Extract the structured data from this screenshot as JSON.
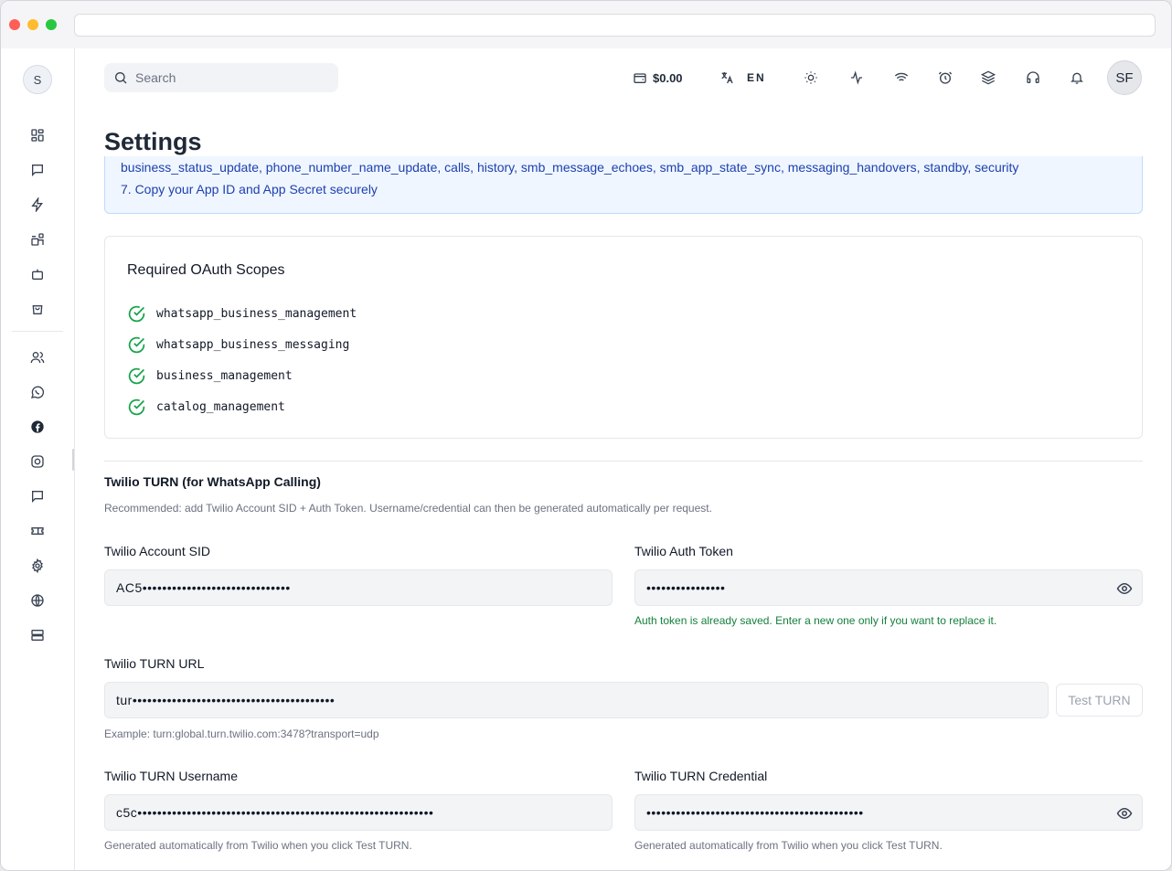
{
  "window": {
    "traffic_lights": [
      "#ff5f57",
      "#febc2e",
      "#28c840"
    ]
  },
  "sidebar": {
    "logo_letter": "S",
    "icons": [
      "dashboard-icon",
      "chat-icon",
      "lightning-icon",
      "apps-icon",
      "bot-icon",
      "shopping-bag-icon",
      "users-icon",
      "whatsapp-icon",
      "facebook-icon",
      "instagram-icon",
      "message-icon",
      "ticket-icon",
      "gear-icon",
      "globe-icon",
      "server-icon"
    ]
  },
  "header": {
    "search_placeholder": "Search",
    "wallet_amount": "$0.00",
    "language": "EN",
    "icons": [
      "sun-icon",
      "activity-icon",
      "wifi-icon",
      "alarm-icon",
      "layers-icon",
      "headset-icon",
      "bell-icon"
    ],
    "avatar_initials": "SF"
  },
  "page": {
    "title": "Settings"
  },
  "info": {
    "line1": "business_status_update, phone_number_name_update, calls, history, smb_message_echoes, smb_app_state_sync, messaging_handovers, standby, security",
    "line2": "7. Copy your App ID and App Secret securely"
  },
  "oauth": {
    "title": "Required OAuth Scopes",
    "scopes": [
      "whatsapp_business_management",
      "whatsapp_business_messaging",
      "business_management",
      "catalog_management"
    ],
    "check_color": "#16a34a"
  },
  "twilio": {
    "title": "Twilio TURN (for WhatsApp Calling)",
    "description": "Recommended: add Twilio Account SID + Auth Token. Username/credential can then be generated automatically per request.",
    "account_sid_label": "Twilio Account SID",
    "account_sid_value": "AC5••••••••••••••••••••••••••••••",
    "auth_token_label": "Twilio Auth Token",
    "auth_token_value": "••••••••••••••••",
    "auth_token_help": "Auth token is already saved. Enter a new one only if you want to replace it.",
    "turn_url_label": "Twilio TURN URL",
    "turn_url_value": "tur•••••••••••••••••••••••••••••••••••••••••",
    "test_button": "Test TURN",
    "turn_url_help": "Example: turn:global.turn.twilio.com:3478?transport=udp",
    "username_label": "Twilio TURN Username",
    "username_value": "c5c••••••••••••••••••••••••••••••••••••••••••••••••••••••••••••",
    "username_help": "Generated automatically from Twilio when you click Test TURN.",
    "credential_label": "Twilio TURN Credential",
    "credential_value": "••••••••••••••••••••••••••••••••••••••••••••",
    "credential_help": "Generated automatically from Twilio when you click Test TURN."
  }
}
